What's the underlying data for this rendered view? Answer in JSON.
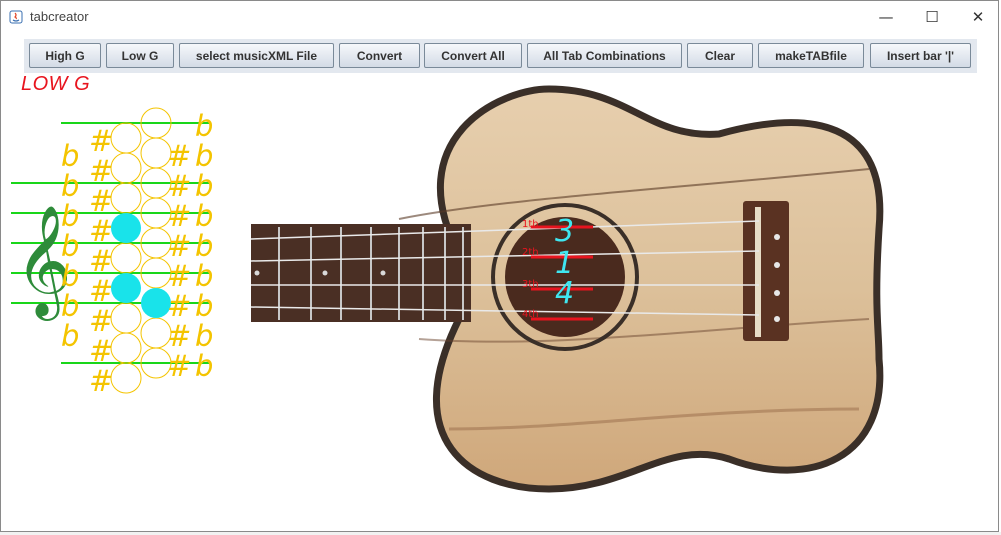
{
  "window": {
    "title": "tabcreator",
    "minimize": "—",
    "maximize": "☐",
    "close": "✕"
  },
  "toolbar": {
    "buttons": [
      "High G",
      "Low G",
      "select musicXML File",
      "Convert",
      "Convert All",
      "All Tab Combinations",
      "Clear",
      "makeTABfile",
      "Insert bar '|'"
    ]
  },
  "mode_label": "LOW G",
  "notation": {
    "flat_symbol": "b",
    "sharp_symbol": "#",
    "filled_notes_color": "#19e3ea",
    "accidental_color": "#f4c400",
    "staff_color": "#19d619"
  },
  "tab": {
    "fret_labels": [
      "1th",
      "2th",
      "3th",
      "4th"
    ],
    "digits": [
      "3",
      "1",
      "4"
    ],
    "digit_color": "#3fe6f0",
    "fret_line_color": "#e8141e"
  }
}
